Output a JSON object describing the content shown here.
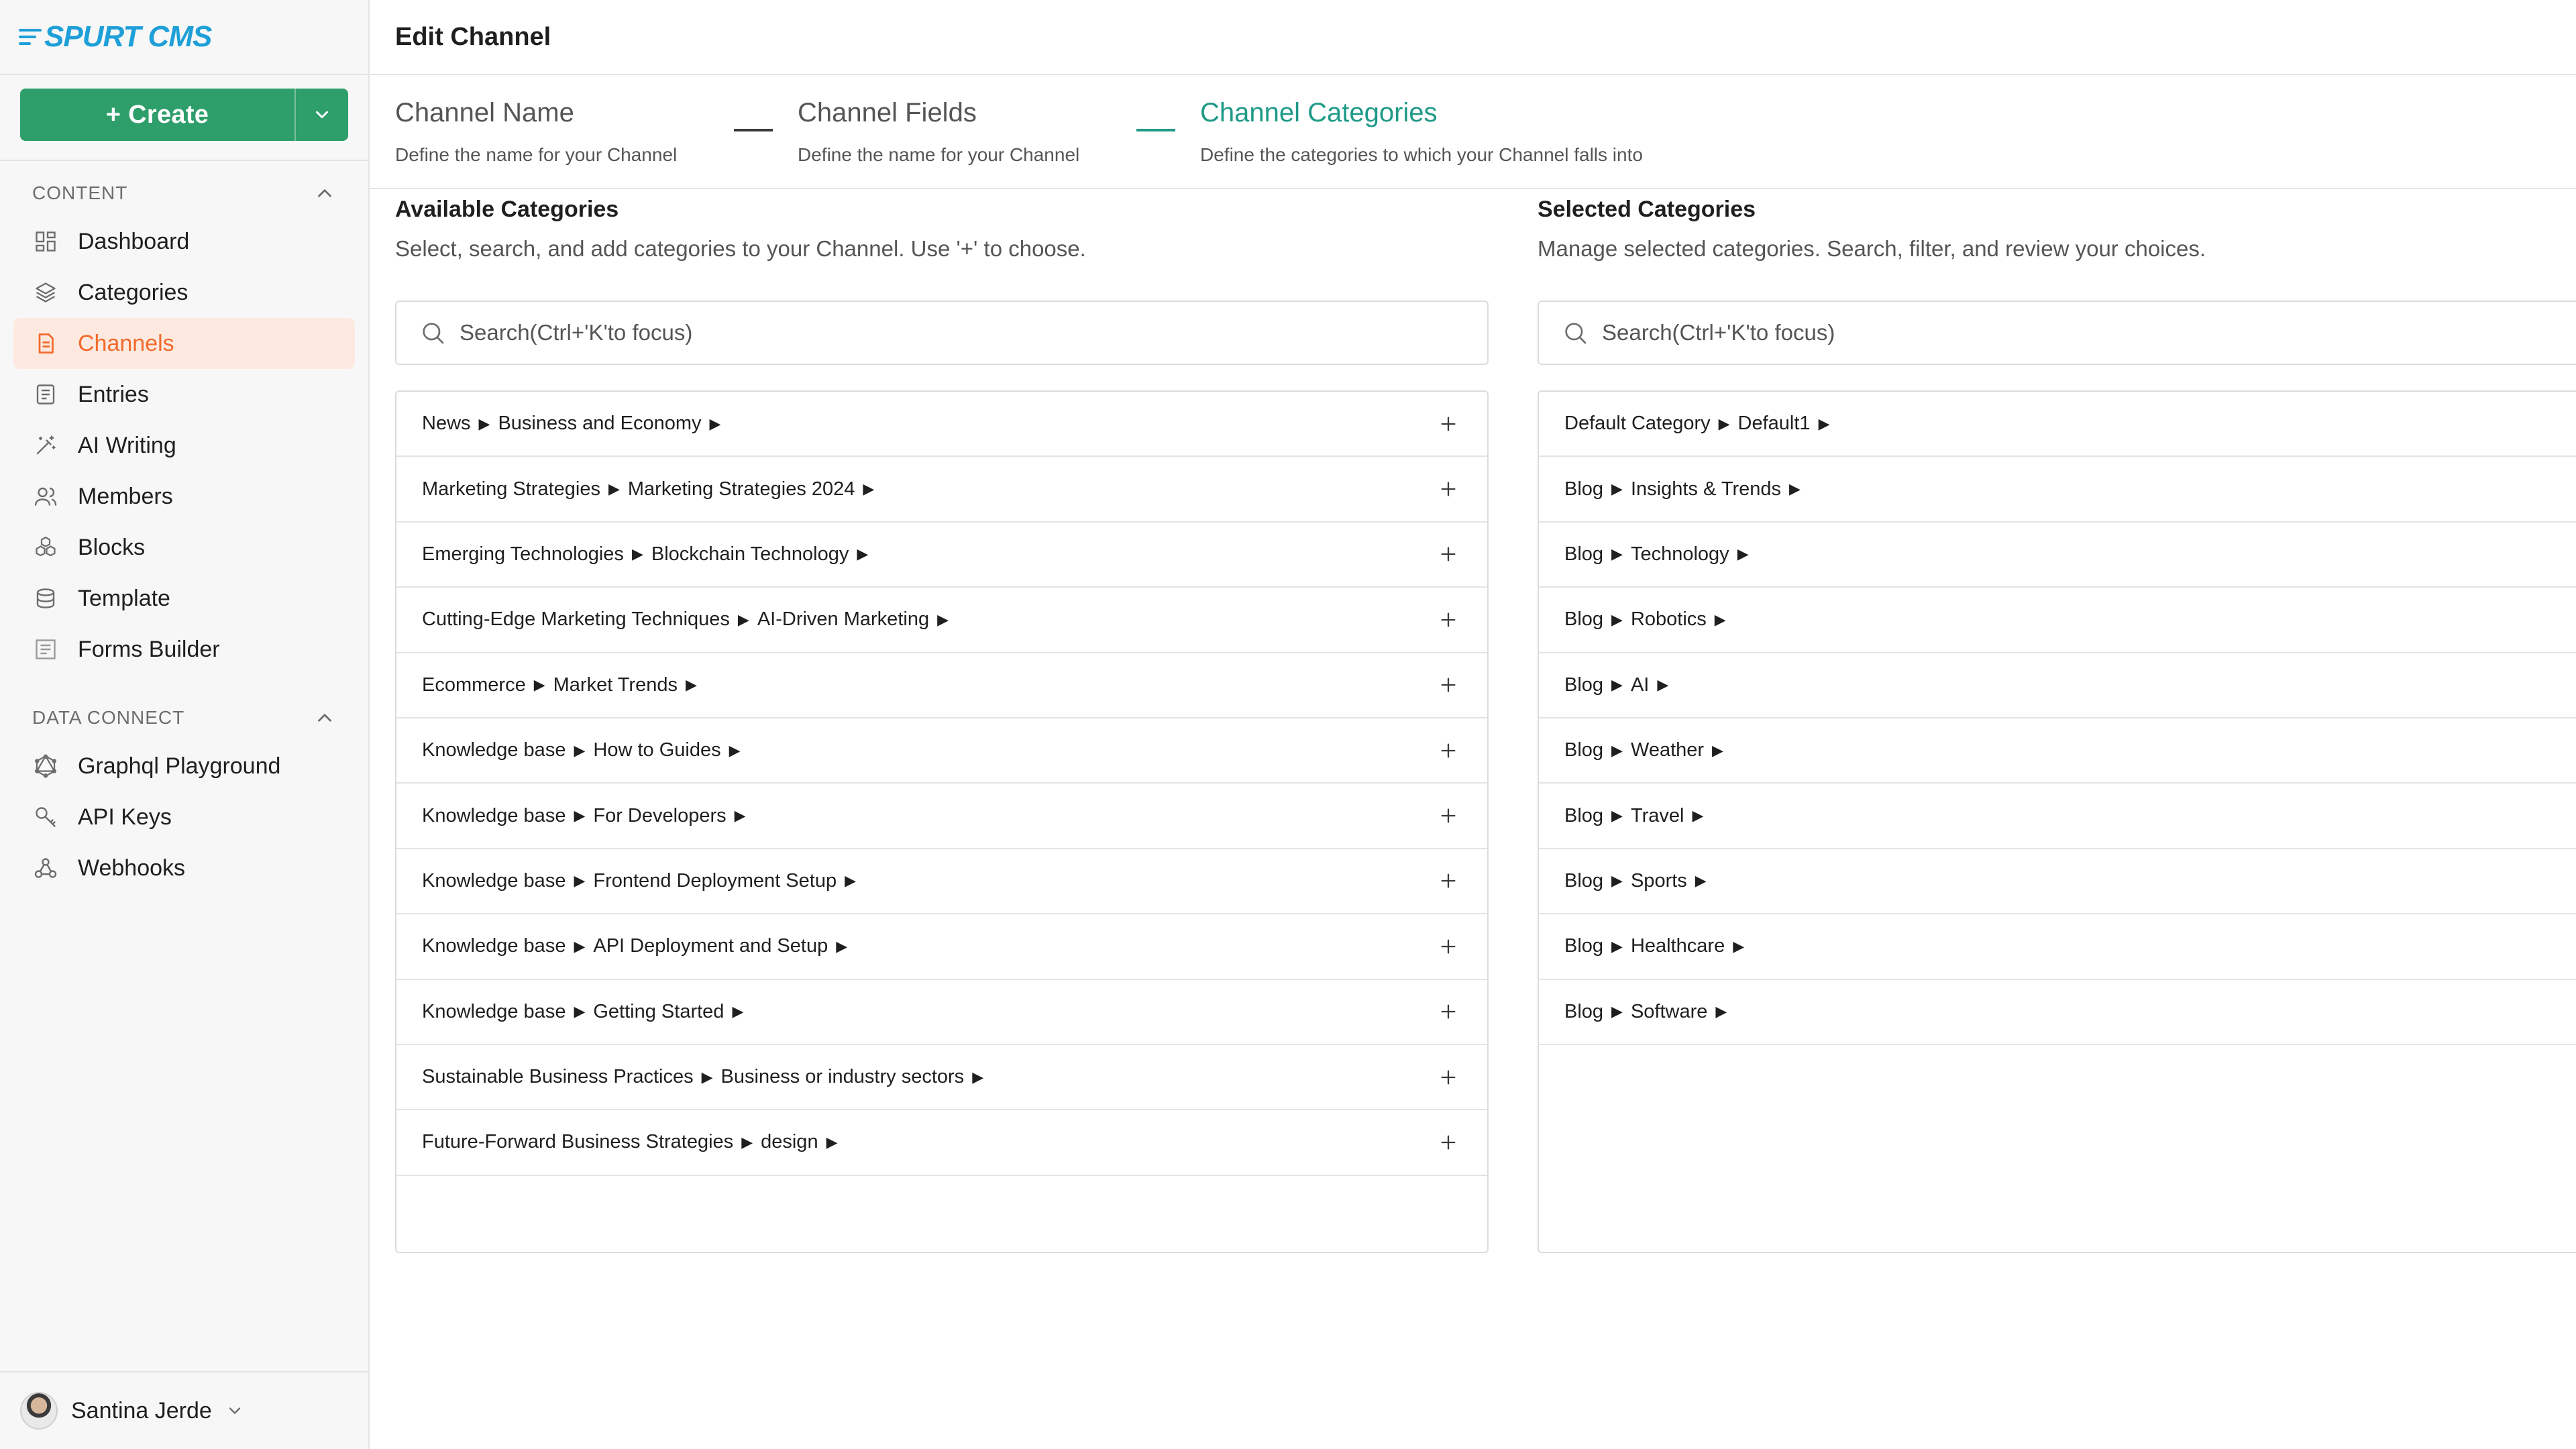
{
  "brand": {
    "logo_text": "SPURT CMS",
    "logo_color": "#1e9fd8"
  },
  "create_button": {
    "label": "+ Create"
  },
  "sidebar": {
    "content_section": {
      "label": "CONTENT",
      "items": [
        {
          "label": "Dashboard",
          "icon": "dashboard-icon"
        },
        {
          "label": "Categories",
          "icon": "layers-icon"
        },
        {
          "label": "Channels",
          "icon": "document-icon",
          "active": true
        },
        {
          "label": "Entries",
          "icon": "list-doc-icon"
        },
        {
          "label": "AI Writing",
          "icon": "magic-wand-icon"
        },
        {
          "label": "Members",
          "icon": "users-icon"
        },
        {
          "label": "Blocks",
          "icon": "blocks-icon"
        },
        {
          "label": "Template",
          "icon": "template-icon"
        },
        {
          "label": "Forms Builder",
          "icon": "form-icon"
        }
      ]
    },
    "data_section": {
      "label": "DATA CONNECT",
      "items": [
        {
          "label": "Graphql Playground",
          "icon": "graphql-icon"
        },
        {
          "label": "API Keys",
          "icon": "key-icon"
        },
        {
          "label": "Webhooks",
          "icon": "webhook-icon"
        }
      ]
    },
    "user": {
      "name": "Santina Jerde"
    }
  },
  "page": {
    "title": "Edit Channel"
  },
  "stepper": [
    {
      "title": "Channel Name",
      "desc": "Define the name for your Channel"
    },
    {
      "title": "Channel Fields",
      "desc": "Define the name for your Channel"
    },
    {
      "title": "Channel Categories",
      "desc": "Define the categories to which your Channel falls into",
      "active": true
    }
  ],
  "available": {
    "title": "Available Categories",
    "subtitle": "Select, search, and add categories to your Channel. Use '+' to choose.",
    "search_placeholder": "Search(Ctrl+'K'to focus)",
    "rows": [
      [
        "News",
        "Business and Economy"
      ],
      [
        "Marketing Strategies",
        "Marketing Strategies 2024"
      ],
      [
        "Emerging Technologies",
        "Blockchain Technology"
      ],
      [
        "Cutting-Edge Marketing Techniques",
        "AI-Driven Marketing"
      ],
      [
        "Ecommerce",
        "Market Trends"
      ],
      [
        "Knowledge base",
        "How to Guides"
      ],
      [
        "Knowledge base",
        "For Developers"
      ],
      [
        "Knowledge base",
        "Frontend Deployment Setup"
      ],
      [
        "Knowledge base",
        "API Deployment and Setup"
      ],
      [
        "Knowledge base",
        "Getting Started"
      ],
      [
        "Sustainable Business Practices",
        "Business or industry sectors"
      ],
      [
        "Future-Forward Business Strategies",
        "design"
      ]
    ]
  },
  "selected": {
    "title": "Selected Categories",
    "subtitle": "Manage selected categories. Search, filter, and review your choices.",
    "search_placeholder": "Search(Ctrl+'K'to focus)",
    "rows": [
      [
        "Default Category",
        "Default1"
      ],
      [
        "Blog",
        "Insights & Trends"
      ],
      [
        "Blog",
        "Technology"
      ],
      [
        "Blog",
        "Robotics"
      ],
      [
        "Blog",
        "AI"
      ],
      [
        "Blog",
        "Weather"
      ],
      [
        "Blog",
        "Travel"
      ],
      [
        "Blog",
        "Sports"
      ],
      [
        "Blog",
        "Healthcare"
      ],
      [
        "Blog",
        "Software"
      ]
    ]
  },
  "colors": {
    "accent_green": "#2e9e6b",
    "step_active": "#1f9a87",
    "nav_active_bg": "#fde9e0",
    "nav_active_text": "#f26a2b"
  }
}
